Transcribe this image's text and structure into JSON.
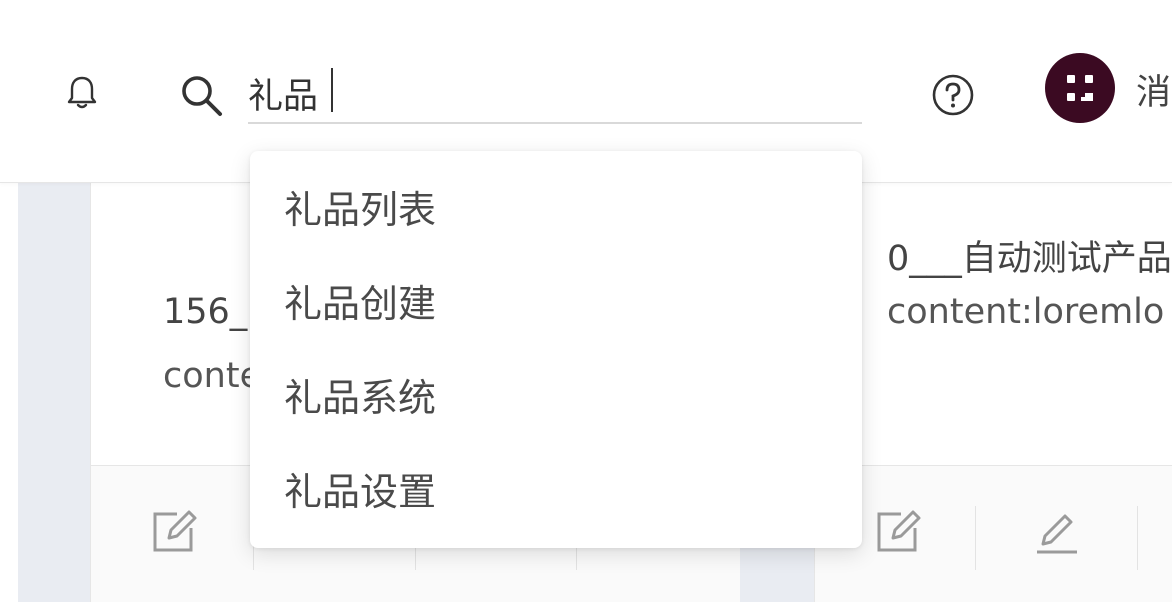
{
  "header": {
    "search": {
      "value": "礼品",
      "placeholder": ""
    },
    "username": "消"
  },
  "dropdown": {
    "items": [
      {
        "label": "礼品列表"
      },
      {
        "label": "礼品创建"
      },
      {
        "label": "礼品系统"
      },
      {
        "label": "礼品设置"
      }
    ]
  },
  "cards": [
    {
      "title": "156_",
      "text": "conte"
    },
    {
      "title": "0___自动测试产品",
      "text": "content:loremlo"
    }
  ],
  "colors": {
    "avatar_bg": "#3b0a22",
    "icon_gray": "#9a9a9a"
  }
}
